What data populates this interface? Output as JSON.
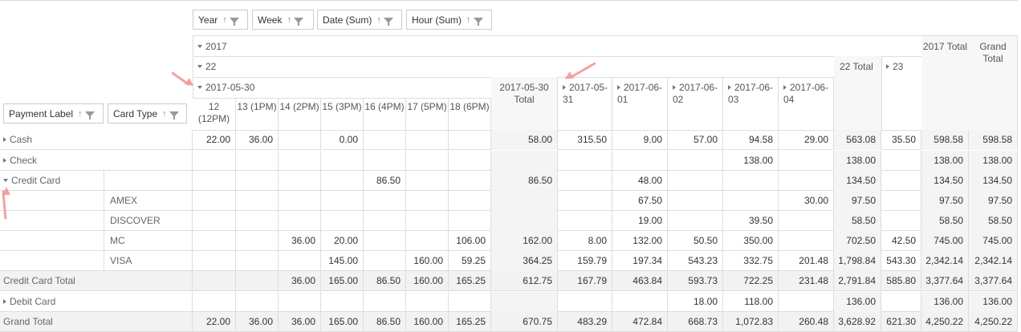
{
  "column_fields": [
    {
      "label": "Year"
    },
    {
      "label": "Week"
    },
    {
      "label": "Date (Sum)"
    },
    {
      "label": "Hour (Sum)"
    }
  ],
  "row_fields": [
    {
      "label": "Payment Label"
    },
    {
      "label": "Card Type"
    }
  ],
  "year_header": "2017",
  "week_header": "22",
  "week_total_header": "22 Total",
  "next_week_header": "23",
  "year_total_header": "2017 Total",
  "grand_total_header": "Grand Total",
  "date_header": "2017-05-30",
  "date_total_header": "2017-05-30 Total",
  "hours": [
    "12 (12PM)",
    "13 (1PM)",
    "14 (2PM)",
    "15 (3PM)",
    "16 (4PM)",
    "17 (5PM)",
    "18 (6PM)"
  ],
  "other_dates": [
    "2017-05-31",
    "2017-06-01",
    "2017-06-02",
    "2017-06-03",
    "2017-06-04"
  ],
  "rows": [
    {
      "label": "Cash",
      "indent": 0,
      "toggle": "collapsed",
      "total": false,
      "values": [
        "22.00",
        "36.00",
        "",
        "0.00",
        "",
        "",
        "",
        "58.00",
        "315.50",
        "9.00",
        "57.00",
        "94.58",
        "29.00",
        "563.08",
        "35.50",
        "598.58",
        "598.58"
      ]
    },
    {
      "label": "Check",
      "indent": 0,
      "toggle": "collapsed",
      "total": false,
      "values": [
        "",
        "",
        "",
        "",
        "",
        "",
        "",
        "",
        "",
        "",
        "",
        "138.00",
        "",
        "138.00",
        "",
        "138.00",
        "138.00"
      ]
    },
    {
      "label": "Credit Card",
      "indent": 0,
      "toggle": "expanded",
      "total": false,
      "values": [
        "",
        "",
        "",
        "",
        "86.50",
        "",
        "",
        "86.50",
        "",
        "48.00",
        "",
        "",
        "",
        "134.50",
        "",
        "134.50",
        "134.50"
      ]
    },
    {
      "label": "AMEX",
      "indent": 1,
      "toggle": "none",
      "total": false,
      "values": [
        "",
        "",
        "",
        "",
        "",
        "",
        "",
        "",
        "",
        "67.50",
        "",
        "",
        "30.00",
        "97.50",
        "",
        "97.50",
        "97.50"
      ]
    },
    {
      "label": "DISCOVER",
      "indent": 1,
      "toggle": "none",
      "total": false,
      "values": [
        "",
        "",
        "",
        "",
        "",
        "",
        "",
        "",
        "",
        "19.00",
        "",
        "39.50",
        "",
        "58.50",
        "",
        "58.50",
        "58.50"
      ]
    },
    {
      "label": "MC",
      "indent": 1,
      "toggle": "none",
      "total": false,
      "values": [
        "",
        "",
        "36.00",
        "20.00",
        "",
        "",
        "106.00",
        "162.00",
        "8.00",
        "132.00",
        "50.50",
        "350.00",
        "",
        "702.50",
        "42.50",
        "745.00",
        "745.00"
      ]
    },
    {
      "label": "VISA",
      "indent": 1,
      "toggle": "none",
      "total": false,
      "values": [
        "",
        "",
        "",
        "145.00",
        "",
        "160.00",
        "59.25",
        "364.25",
        "159.79",
        "197.34",
        "543.23",
        "332.75",
        "201.48",
        "1,798.84",
        "543.30",
        "2,342.14",
        "2,342.14"
      ]
    },
    {
      "label": "Credit Card Total",
      "indent": 0,
      "toggle": "none",
      "total": true,
      "values": [
        "",
        "",
        "36.00",
        "165.00",
        "86.50",
        "160.00",
        "165.25",
        "612.75",
        "167.79",
        "463.84",
        "593.73",
        "722.25",
        "231.48",
        "2,791.84",
        "585.80",
        "3,377.64",
        "3,377.64"
      ]
    },
    {
      "label": "Debit Card",
      "indent": 0,
      "toggle": "collapsed",
      "total": false,
      "values": [
        "",
        "",
        "",
        "",
        "",
        "",
        "",
        "",
        "",
        "",
        "18.00",
        "118.00",
        "",
        "136.00",
        "",
        "136.00",
        "136.00"
      ]
    },
    {
      "label": "Grand Total",
      "indent": 0,
      "toggle": "none",
      "total": true,
      "values": [
        "22.00",
        "36.00",
        "36.00",
        "165.00",
        "86.50",
        "160.00",
        "165.25",
        "670.75",
        "483.29",
        "472.84",
        "668.73",
        "1,072.83",
        "260.48",
        "3,628.92",
        "621.30",
        "4,250.22",
        "4,250.22"
      ]
    }
  ],
  "colors": {
    "annotation_arrow": "#f4a0a0",
    "grid_line": "#dddddd",
    "header_bg": "#f7f7f7"
  }
}
